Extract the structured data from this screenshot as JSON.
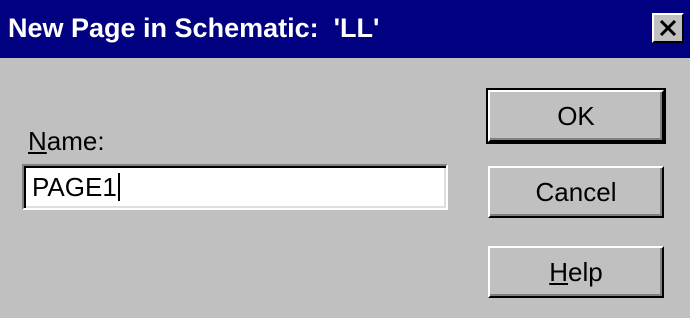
{
  "window": {
    "title": "New Page in Schematic:  'LL'",
    "close_icon": "close-icon"
  },
  "form": {
    "name_label_accel": "N",
    "name_label_rest": "ame:",
    "name_value": "PAGE1"
  },
  "buttons": {
    "ok_label": "OK",
    "cancel_label": "Cancel",
    "help_accel": "H",
    "help_rest": "elp"
  },
  "colors": {
    "titlebar": "#000080",
    "face": "#c0c0c0"
  }
}
